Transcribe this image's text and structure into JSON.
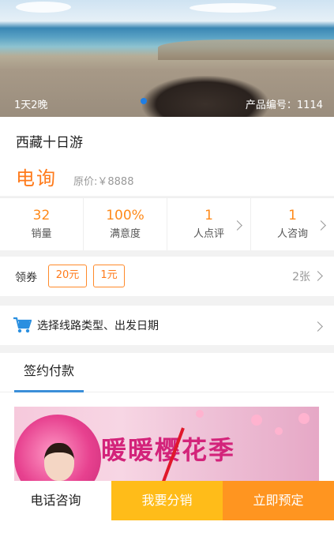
{
  "hero": {
    "duration": "1天2晚",
    "product_code": "产品编号：1114"
  },
  "product": {
    "title": "西藏十日游",
    "price": "电询",
    "original_price": "原价:￥8888"
  },
  "stats": [
    {
      "value": "32",
      "label": "销量"
    },
    {
      "value": "100%",
      "label": "满意度"
    },
    {
      "value": "1",
      "label": "人点评"
    },
    {
      "value": "1",
      "label": "人咨询"
    }
  ],
  "coupon": {
    "label": "领券",
    "tags": [
      "20元",
      "1元"
    ],
    "count": "2张"
  },
  "route": {
    "label": "选择线路类型、出发日期"
  },
  "tabs": {
    "active": "签约付款"
  },
  "banner": {
    "headline": "暖暖樱花季"
  },
  "bottom_bar": {
    "phone": "电话咨询",
    "distribute": "我要分销",
    "book": "立即预定"
  },
  "colors": {
    "accent_orange": "#ff7a1a",
    "yellow_button": "#ffbc19",
    "orange_button": "#ff9520",
    "tab_underline": "#3b8fd9"
  }
}
